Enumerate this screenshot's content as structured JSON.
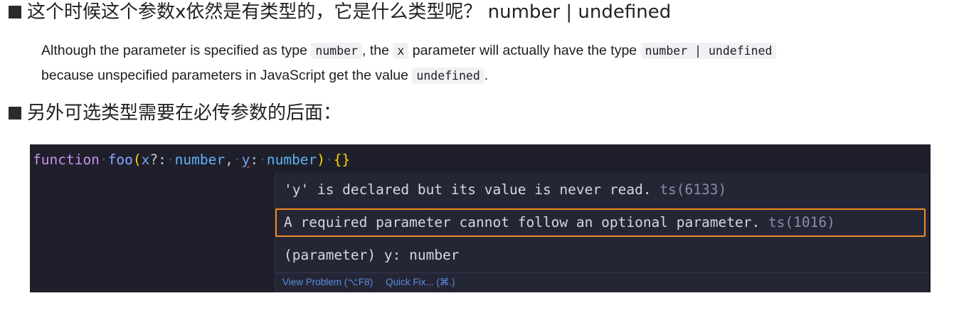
{
  "heading1": "这个时候这个参数x依然是有类型的，它是什么类型呢？ number | undefined",
  "doc": {
    "part1": "Although the parameter is specified as type ",
    "code1": "number",
    "part2": ", the ",
    "code2": "x",
    "part3": " parameter will actually have the type ",
    "code3": "number | undefined",
    "part4": "because unspecified parameters in JavaScript get the value ",
    "code4": "undefined",
    "part5": "."
  },
  "heading2": "另外可选类型需要在必传参数的后面：",
  "editor": {
    "tokens": {
      "kw_function": "function",
      "fn_name": "foo",
      "paren_open": "(",
      "param_x": "x",
      "optional_colon": "?:",
      "type_number_1": "number",
      "comma": ",",
      "param_y": "y",
      "colon": ":",
      "type_number_2": "number",
      "paren_close": ")",
      "braces": "{}"
    },
    "hover": {
      "message1": "'y' is declared but its value is never read.",
      "code1": "ts(6133)",
      "message2": "A required parameter cannot follow an optional parameter.",
      "code2": "ts(1016)",
      "signature": "(parameter) y: number",
      "view_problem": "View Problem (⌥F8)",
      "quick_fix": "Quick Fix... (⌘.)"
    }
  },
  "colors": {
    "editor_bg": "#1e1f2b",
    "hover_bg": "#252635",
    "highlight_border": "#f08a24",
    "link": "#5b8de0"
  }
}
